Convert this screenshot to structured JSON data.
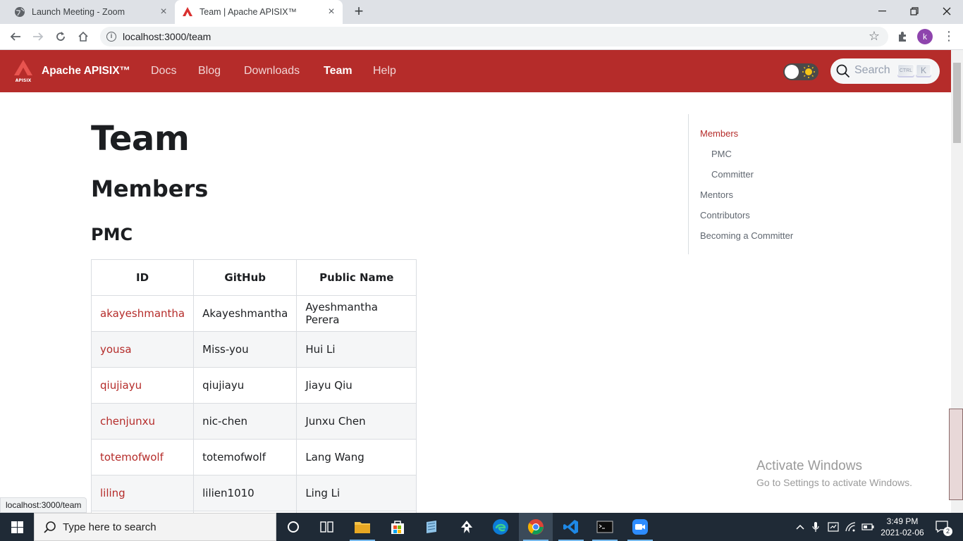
{
  "browser": {
    "tabs": [
      {
        "title": "Launch Meeting - Zoom",
        "active": false
      },
      {
        "title": "Team | Apache APISIX™",
        "active": true
      }
    ],
    "url": "localhost:3000/team",
    "profile_initial": "k",
    "status_url": "localhost:3000/team"
  },
  "site": {
    "brand": "Apache APISIX™",
    "nav": [
      "Docs",
      "Blog",
      "Downloads",
      "Team",
      "Help"
    ],
    "active_nav": "Team",
    "search": {
      "placeholder": "Search",
      "key_ctrl": "CTRL",
      "key_k": "K"
    },
    "accent_color": "#b52c2a"
  },
  "page": {
    "title": "Team",
    "section": "Members",
    "subsection": "PMC",
    "table": {
      "headers": [
        "ID",
        "GitHub",
        "Public Name"
      ],
      "rows": [
        [
          "akayeshmantha",
          "Akayeshmantha",
          "Ayeshmantha Perera"
        ],
        [
          "yousa",
          "Miss-you",
          "Hui Li"
        ],
        [
          "qiujiayu",
          "qiujiayu",
          "Jiayu Qiu"
        ],
        [
          "chenjunxu",
          "nic-chen",
          "Junxu Chen"
        ],
        [
          "totemofwolf",
          "totemofwolf",
          "Lang Wang"
        ],
        [
          "liling",
          "lilien1010",
          "Ling Li"
        ]
      ]
    },
    "toc": [
      {
        "label": "Members",
        "active": true,
        "indent": false
      },
      {
        "label": "PMC",
        "active": false,
        "indent": true
      },
      {
        "label": "Committer",
        "active": false,
        "indent": true
      },
      {
        "label": "Mentors",
        "active": false,
        "indent": false
      },
      {
        "label": "Contributors",
        "active": false,
        "indent": false
      },
      {
        "label": "Becoming a Committer",
        "active": false,
        "indent": false
      }
    ]
  },
  "watermark": {
    "line1": "Activate Windows",
    "line2": "Go to Settings to activate Windows."
  },
  "taskbar": {
    "search_placeholder": "Type here to search",
    "time": "3:49 PM",
    "date": "2021-02-06",
    "notifications": "2",
    "apps": [
      "task-view",
      "file-explorer",
      "store",
      "sticky-app",
      "inkscape",
      "edge",
      "chrome",
      "vscode",
      "terminal",
      "zoom"
    ]
  }
}
